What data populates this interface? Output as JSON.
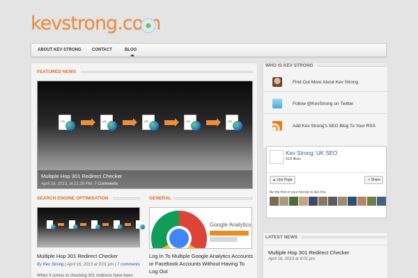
{
  "logo": {
    "text": "kevstrong.com"
  },
  "nav": {
    "items": [
      "ABOUT KEV STRONG",
      "CONTACT",
      "BLOG"
    ],
    "active": "BLOG"
  },
  "featured": {
    "section_title": "FEATURED NEWS",
    "doc_tag": "URL",
    "slide_title": "Multiple Hop 301 Redirect Checker",
    "slide_date": "April 16, 2013, at 21:30 PM",
    "slide_comments": "7 Comments"
  },
  "seo": {
    "section_title": "SEARCH ENGINE OPTIMISATION",
    "post_title": "Multiple Hop 301 Redirect Checker",
    "by": "By",
    "author": "Kev Strong",
    "date": "April 16, 2013 at 9:01 pm",
    "sep": "|",
    "comments": "7 comments",
    "excerpt": "When it comes to checking 301 redirects have been"
  },
  "general": {
    "section_title": "GENERAL",
    "ga_text": "Google Analytics",
    "post_title": "Log In To Multiple Google Analytics Accounts or Facebook Accounts Without Having To Log Out"
  },
  "sidebar": {
    "who_title": "WHO IS KEV STRONG",
    "links": [
      {
        "text": "Find Out More About Kev Strong",
        "icon": "profile-photo-icon"
      },
      {
        "text": "Follow @KevStrong on Twitter",
        "icon": "twitter-bird-icon"
      },
      {
        "text": "Add Kev Strong's SEO Blog To Your RSS",
        "icon": "rss-feed-icon"
      }
    ],
    "facebook": {
      "page_name": "Kev Strong: UK SEO",
      "likes": "519 likes",
      "like_btn": "Like Page",
      "share_btn": "Share",
      "friends_text": "Be the first of your friends to like this"
    },
    "latest_title": "LATEST NEWS",
    "latest_post_title": "Multiple Hop 301 Redirect Checker",
    "latest_post_date": "April 16, 2013 at 9:01 pm"
  },
  "colors": {
    "accent": "#d86b28",
    "logo": "#ee8e3c",
    "link": "#3b5998"
  }
}
